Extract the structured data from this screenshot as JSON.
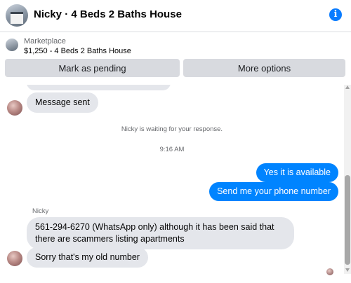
{
  "header": {
    "title": "Nicky · 4 Beds 2 Baths House",
    "info_icon": "info-icon",
    "info_glyph": "i"
  },
  "marketplace": {
    "label": "Marketplace",
    "listing": "$1,250 - 4 Beds 2 Baths House",
    "mark_pending_label": "Mark as pending",
    "more_options_label": "More options"
  },
  "messages": {
    "message_sent": "Message sent",
    "waiting_notice": "Nicky is waiting for your response.",
    "timestamp": "9:16 AM",
    "out_1": "Yes it is available",
    "out_2": "Send me your phone number",
    "sender_name": "Nicky",
    "in_1": "561-294-6270 (WhatsApp only) although it has been said that there are scammers listing apartments",
    "in_2": "Sorry that's my old number"
  },
  "colors": {
    "outgoing_bubble": "#0084ff",
    "incoming_bubble": "#e4e6eb",
    "button_bg": "#d8dadf"
  }
}
